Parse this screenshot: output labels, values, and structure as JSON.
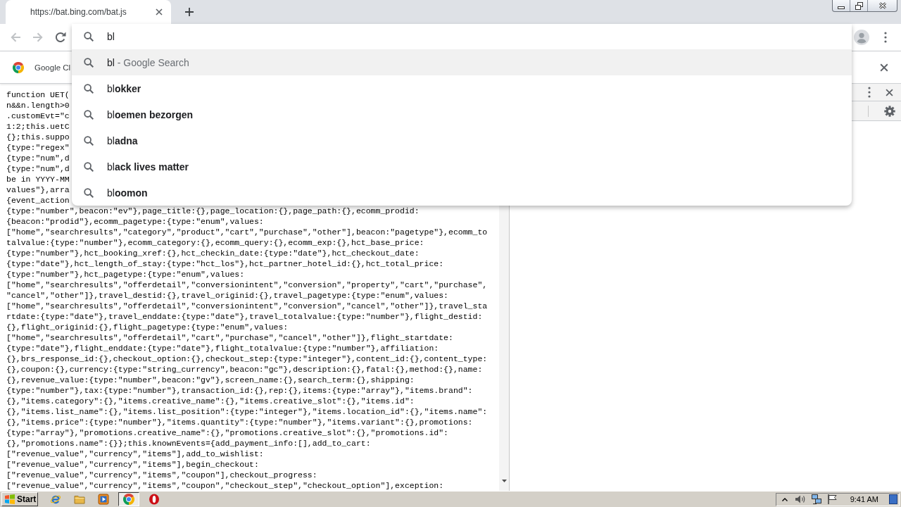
{
  "tab_strip": {
    "tabs": [
      {
        "title": "https://bat.bing.com/bat.js",
        "selected": true
      }
    ]
  },
  "toolbar": {
    "nav_buttons": [
      {
        "kind": "back",
        "disabled": true
      },
      {
        "kind": "forward",
        "disabled": true
      },
      {
        "kind": "reload",
        "disabled": false
      }
    ]
  },
  "omnibox": {
    "value": "bl",
    "suggestions": [
      {
        "text": "bl",
        "description": "- Google Search",
        "selected": true
      },
      {
        "text": "bl**okker**",
        "selected": false
      },
      {
        "text": "bl**oemen bezorgen**",
        "selected": false
      },
      {
        "text": "bl**adna**",
        "selected": false
      },
      {
        "text": "bl**ack lives matter**",
        "selected": false
      },
      {
        "text": "bl**oomon**",
        "selected": false
      }
    ]
  },
  "infobar": {
    "message": "Google Cl"
  },
  "source_view": {
    "lines": [
      "function UET(",
      "n&&n.length>0",
      ".customEvt=\"c",
      "1:2;this.uetC",
      "{};this.suppo",
      "{type:\"regex\"",
      "{type:\"num\",d",
      "{type:\"num\",d",
      "be in YYYY-MM",
      "values\"},arra",
      "{event_action",
      "{type:\"number\",beacon:\"ev\"},page_title:{},page_location:{},page_path:{},ecomm_prodid:",
      "{beacon:\"prodid\"},ecomm_pagetype:{type:\"enum\",values:",
      "[\"home\",\"searchresults\",\"category\",\"product\",\"cart\",\"purchase\",\"other\"],beacon:\"pagetype\"},ecomm_to",
      "talvalue:{type:\"number\"},ecomm_category:{},ecomm_query:{},ecomm_exp:{},hct_base_price:",
      "{type:\"number\"},hct_booking_xref:{},hct_checkin_date:{type:\"date\"},hct_checkout_date:",
      "{type:\"date\"},hct_length_of_stay:{type:\"hct_los\"},hct_partner_hotel_id:{},hct_total_price:",
      "{type:\"number\"},hct_pagetype:{type:\"enum\",values:",
      "[\"home\",\"searchresults\",\"offerdetail\",\"conversionintent\",\"conversion\",\"property\",\"cart\",\"purchase\",",
      "\"cancel\",\"other\"]},travel_destid:{},travel_originid:{},travel_pagetype:{type:\"enum\",values:",
      "[\"home\",\"searchresults\",\"offerdetail\",\"conversionintent\",\"conversion\",\"cancel\",\"other\"]},travel_sta",
      "rtdate:{type:\"date\"},travel_enddate:{type:\"date\"},travel_totalvalue:{type:\"number\"},flight_destid:",
      "{},flight_originid:{},flight_pagetype:{type:\"enum\",values:",
      "[\"home\",\"searchresults\",\"offerdetail\",\"cart\",\"purchase\",\"cancel\",\"other\"]},flight_startdate:",
      "{type:\"date\"},flight_enddate:{type:\"date\"},flight_totalvalue:{type:\"number\"},affiliation:",
      "{},brs_response_id:{},checkout_option:{},checkout_step:{type:\"integer\"},content_id:{},content_type:",
      "{},coupon:{},currency:{type:\"string_currency\",beacon:\"gc\"},description:{},fatal:{},method:{},name:",
      "{},revenue_value:{type:\"number\",beacon:\"gv\"},screen_name:{},search_term:{},shipping:",
      "{type:\"number\"},tax:{type:\"number\"},transaction_id:{},rep:{},items:{type:\"array\"},\"items.brand\":",
      "{},\"items.category\":{},\"items.creative_name\":{},\"items.creative_slot\":{},\"items.id\":",
      "{},\"items.list_name\":{},\"items.list_position\":{type:\"integer\"},\"items.location_id\":{},\"items.name\":",
      "{},\"items.price\":{type:\"number\"},\"items.quantity\":{type:\"number\"},\"items.variant\":{},promotions:",
      "{type:\"array\"},\"promotions.creative_name\":{},\"promotions.creative_slot\":{},\"promotions.id\":",
      "{},\"promotions.name\":{}};this.knownEvents={add_payment_info:[],add_to_cart:",
      "[\"revenue_value\",\"currency\",\"items\"],add_to_wishlist:",
      "[\"revenue_value\",\"currency\",\"items\"],begin_checkout:",
      "[\"revenue_value\",\"currency\",\"items\",\"coupon\"],checkout_progress:",
      "[\"revenue_value\",\"currency\",\"items\",\"coupon\",\"checkout_step\",\"checkout_option\"],exception:"
    ]
  },
  "taskbar": {
    "start_label": "Start",
    "apps": [
      {
        "kind": "e_logo",
        "selected": false
      },
      {
        "kind": "folder",
        "selected": false
      },
      {
        "kind": "play",
        "selected": false
      },
      {
        "kind": "browser",
        "selected": true
      },
      {
        "kind": "ring",
        "selected": false
      }
    ],
    "clock": "9:41 AM"
  }
}
